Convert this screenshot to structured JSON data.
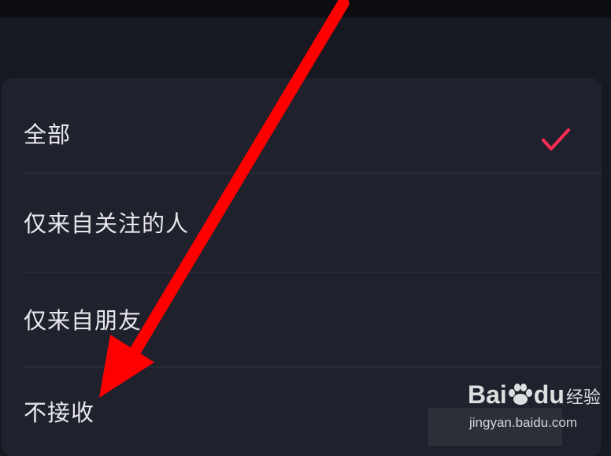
{
  "options": [
    {
      "label": "全部",
      "selected": true
    },
    {
      "label": "仅来自关注的人",
      "selected": false
    },
    {
      "label": "仅来自朋友",
      "selected": false
    },
    {
      "label": "不接收",
      "selected": false
    }
  ],
  "check_icon": "check-icon",
  "accent_color": "#fe2c55",
  "arrow_color": "#ff0000",
  "watermark": {
    "brand": "Bai",
    "brand_end": "du",
    "brand_cn": "经验",
    "url": "jingyan.baidu.com"
  }
}
